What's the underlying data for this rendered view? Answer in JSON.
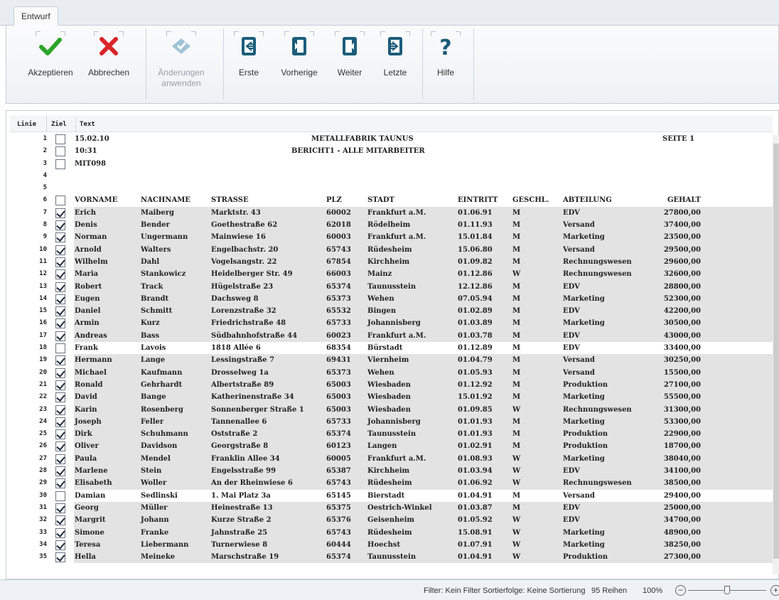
{
  "tab": "Entwurf",
  "ribbon": {
    "accept": "Akzeptieren",
    "cancel": "Abbrechen",
    "apply": "Änderungen anwenden",
    "first": "Erste",
    "prev": "Vorherige",
    "next": "Weiter",
    "last": "Letzte",
    "help": "Hilfe"
  },
  "colors": {
    "accept": "#2aa52a",
    "cancel": "#d9252a",
    "nav": "#1b5d7a",
    "disabled": "#9fc3d6"
  },
  "grid": {
    "headers": {
      "line": "Linie",
      "target": "Ziel",
      "text": "Text"
    },
    "report": {
      "date": "15.02.10",
      "time": "10:31",
      "id": "MIT098",
      "company": "METALLFABRIK TAUNUS",
      "title": "BERICHT1 - ALLE MITARBEITER",
      "page": "SEITE 1"
    },
    "columns": [
      "VORNAME",
      "NACHNAME",
      "STRASSE",
      "PLZ",
      "STADT",
      "EINTRITT",
      "GESCHL.",
      "ABTEILUNG",
      "GEHALT"
    ],
    "employees": [
      {
        "line": "7",
        "checked": true,
        "vorname": "Erich",
        "nachname": "Maiberg",
        "strasse": "Marktstr. 43",
        "plz": "60002",
        "stadt": "Frankfurt a.M.",
        "eintritt": "01.06.91",
        "geschl": "M",
        "abteilung": "EDV",
        "gehalt": "27800,00"
      },
      {
        "line": "8",
        "checked": true,
        "vorname": "Denis",
        "nachname": "Bender",
        "strasse": "Goethestraße 62",
        "plz": "62018",
        "stadt": "Rödelheim",
        "eintritt": "01.11.93",
        "geschl": "M",
        "abteilung": "Versand",
        "gehalt": "37400,00"
      },
      {
        "line": "9",
        "checked": true,
        "vorname": "Norman",
        "nachname": "Ungermann",
        "strasse": "Mainwiese 16",
        "plz": "60003",
        "stadt": "Frankfurt a.M.",
        "eintritt": "15.01.84",
        "geschl": "M",
        "abteilung": "Marketing",
        "gehalt": "23500,00"
      },
      {
        "line": "10",
        "checked": true,
        "vorname": "Arnold",
        "nachname": "Walters",
        "strasse": "Engelbachstr. 20",
        "plz": "65743",
        "stadt": "Rüdesheim",
        "eintritt": "15.06.80",
        "geschl": "M",
        "abteilung": "Versand",
        "gehalt": "29500,00"
      },
      {
        "line": "11",
        "checked": true,
        "vorname": "Wilhelm",
        "nachname": "Dahl",
        "strasse": "Vogelsangstr. 22",
        "plz": "67854",
        "stadt": "Kirchheim",
        "eintritt": "01.09.82",
        "geschl": "M",
        "abteilung": "Rechnungswesen",
        "gehalt": "29600,00"
      },
      {
        "line": "12",
        "checked": true,
        "vorname": "Maria",
        "nachname": "Stankowicz",
        "strasse": "Heidelberger Str. 49",
        "plz": "66003",
        "stadt": "Mainz",
        "eintritt": "01.12.86",
        "geschl": "W",
        "abteilung": "Rechnungswesen",
        "gehalt": "32600,00"
      },
      {
        "line": "13",
        "checked": true,
        "vorname": "Robert",
        "nachname": "Track",
        "strasse": "Hügelstraße 23",
        "plz": "65374",
        "stadt": "Taunusstein",
        "eintritt": "12.12.86",
        "geschl": "M",
        "abteilung": "EDV",
        "gehalt": "28800,00"
      },
      {
        "line": "14",
        "checked": true,
        "vorname": "Eugen",
        "nachname": "Brandt",
        "strasse": "Dachsweg 8",
        "plz": "65373",
        "stadt": "Wehen",
        "eintritt": "07.05.94",
        "geschl": "M",
        "abteilung": "Marketing",
        "gehalt": "52300,00"
      },
      {
        "line": "15",
        "checked": true,
        "vorname": "Daniel",
        "nachname": "Schmitt",
        "strasse": "Lorenzstraße 32",
        "plz": "65532",
        "stadt": "Bingen",
        "eintritt": "01.02.89",
        "geschl": "M",
        "abteilung": "EDV",
        "gehalt": "42200,00"
      },
      {
        "line": "16",
        "checked": true,
        "vorname": "Armin",
        "nachname": "Kurz",
        "strasse": "Friedrichstraße 48",
        "plz": "65733",
        "stadt": "Johannisberg",
        "eintritt": "01.03.89",
        "geschl": "M",
        "abteilung": "Marketing",
        "gehalt": "30500,00"
      },
      {
        "line": "17",
        "checked": true,
        "vorname": "Andreas",
        "nachname": "Bass",
        "strasse": "Südbahnhofstraße 44",
        "plz": "60023",
        "stadt": "Frankfurt a.M.",
        "eintritt": "01.03.78",
        "geschl": "M",
        "abteilung": "EDV",
        "gehalt": "43000,00"
      },
      {
        "line": "18",
        "checked": false,
        "vorname": "Frank",
        "nachname": "Lavois",
        "strasse": "1818 Allée 6",
        "plz": "68354",
        "stadt": "Bürstadt",
        "eintritt": "01.12.89",
        "geschl": "M",
        "abteilung": "EDV",
        "gehalt": "33400,00"
      },
      {
        "line": "19",
        "checked": true,
        "vorname": "Hermann",
        "nachname": "Lange",
        "strasse": "Lessingstraße 7",
        "plz": "69431",
        "stadt": "Viernheim",
        "eintritt": "01.04.79",
        "geschl": "M",
        "abteilung": "Versand",
        "gehalt": "30250,00"
      },
      {
        "line": "20",
        "checked": true,
        "vorname": "Michael",
        "nachname": "Kaufmann",
        "strasse": "Drosselweg 1a",
        "plz": "65373",
        "stadt": "Wehen",
        "eintritt": "01.05.93",
        "geschl": "M",
        "abteilung": "Versand",
        "gehalt": "15500,00"
      },
      {
        "line": "21",
        "checked": true,
        "vorname": "Ronald",
        "nachname": "Gehrhardt",
        "strasse": "Albertstraße 89",
        "plz": "65003",
        "stadt": "Wiesbaden",
        "eintritt": "01.12.92",
        "geschl": "M",
        "abteilung": "Produktion",
        "gehalt": "27100,00"
      },
      {
        "line": "22",
        "checked": true,
        "vorname": "David",
        "nachname": "Bange",
        "strasse": "Katherinenstraße 34",
        "plz": "65003",
        "stadt": "Wiesbaden",
        "eintritt": "15.01.92",
        "geschl": "M",
        "abteilung": "Marketing",
        "gehalt": "55500,00"
      },
      {
        "line": "23",
        "checked": true,
        "vorname": "Karin",
        "nachname": "Rosenberg",
        "strasse": "Sonnenberger Straße 1",
        "plz": "65003",
        "stadt": "Wiesbaden",
        "eintritt": "01.09.85",
        "geschl": "W",
        "abteilung": "Rechnungswesen",
        "gehalt": "31300,00"
      },
      {
        "line": "24",
        "checked": true,
        "vorname": "Joseph",
        "nachname": "Feller",
        "strasse": "Tannenallee 6",
        "plz": "65733",
        "stadt": "Johannisberg",
        "eintritt": "01.01.93",
        "geschl": "M",
        "abteilung": "Marketing",
        "gehalt": "53300,00"
      },
      {
        "line": "25",
        "checked": true,
        "vorname": "Dirk",
        "nachname": "Schuhmann",
        "strasse": "Oststraße 2",
        "plz": "65374",
        "stadt": "Taunusstein",
        "eintritt": "01.01.93",
        "geschl": "M",
        "abteilung": "Produktion",
        "gehalt": "22900,00"
      },
      {
        "line": "26",
        "checked": true,
        "vorname": "Oliver",
        "nachname": "Davidson",
        "strasse": "Georgstraße 8",
        "plz": "60123",
        "stadt": "Langen",
        "eintritt": "01.02.91",
        "geschl": "M",
        "abteilung": "Produktion",
        "gehalt": "18700,00"
      },
      {
        "line": "27",
        "checked": true,
        "vorname": "Paula",
        "nachname": "Mendel",
        "strasse": "Franklin Allee 34",
        "plz": "60005",
        "stadt": "Frankfurt a.M.",
        "eintritt": "01.08.93",
        "geschl": "W",
        "abteilung": "Marketing",
        "gehalt": "38040,00"
      },
      {
        "line": "28",
        "checked": true,
        "vorname": "Marlene",
        "nachname": "Stein",
        "strasse": "Engelsstraße 99",
        "plz": "65387",
        "stadt": "Kirchheim",
        "eintritt": "01.03.94",
        "geschl": "W",
        "abteilung": "EDV",
        "gehalt": "34100,00"
      },
      {
        "line": "29",
        "checked": true,
        "vorname": "Elisabeth",
        "nachname": "Woller",
        "strasse": "An der Rheinwiese 6",
        "plz": "65743",
        "stadt": "Rüdesheim",
        "eintritt": "01.06.92",
        "geschl": "W",
        "abteilung": "Rechnungswesen",
        "gehalt": "38500,00"
      },
      {
        "line": "30",
        "checked": false,
        "vorname": "Damian",
        "nachname": "Sedlinski",
        "strasse": "1. Mai Platz 3a",
        "plz": "65145",
        "stadt": "Bierstadt",
        "eintritt": "01.04.91",
        "geschl": "M",
        "abteilung": "Versand",
        "gehalt": "29400,00"
      },
      {
        "line": "31",
        "checked": true,
        "vorname": "Georg",
        "nachname": "Müller",
        "strasse": "Heinestraße 13",
        "plz": "65375",
        "stadt": "Oestrich-Winkel",
        "eintritt": "01.03.87",
        "geschl": "M",
        "abteilung": "EDV",
        "gehalt": "25000,00"
      },
      {
        "line": "32",
        "checked": true,
        "vorname": "Margrit",
        "nachname": "Johann",
        "strasse": "Kurze Straße 2",
        "plz": "65376",
        "stadt": "Geisenheim",
        "eintritt": "01.05.92",
        "geschl": "W",
        "abteilung": "EDV",
        "gehalt": "34700,00"
      },
      {
        "line": "33",
        "checked": true,
        "vorname": "Simone",
        "nachname": "Franke",
        "strasse": "Jahnstraße 25",
        "plz": "65743",
        "stadt": "Rüdesheim",
        "eintritt": "15.08.91",
        "geschl": "W",
        "abteilung": "Marketing",
        "gehalt": "48900,00"
      },
      {
        "line": "34",
        "checked": true,
        "vorname": "Teresa",
        "nachname": "Liebermann",
        "strasse": "Turnerwiese 8",
        "plz": "60444",
        "stadt": "Hoechst",
        "eintritt": "01.07.91",
        "geschl": "W",
        "abteilung": "Marketing",
        "gehalt": "38250,00"
      },
      {
        "line": "35",
        "checked": true,
        "vorname": "Hella",
        "nachname": "Meineke",
        "strasse": "Marschstraße 19",
        "plz": "65374",
        "stadt": "Taunusstein",
        "eintritt": "01.04.91",
        "geschl": "W",
        "abteilung": "Produktion",
        "gehalt": "27300,00"
      }
    ]
  },
  "status": {
    "filter": "Filter: Kein Filter Sortierfolge: Keine Sortierung",
    "rows": "95 Reihen",
    "zoom": "100%",
    "zoom_level_fraction": 0.5
  }
}
